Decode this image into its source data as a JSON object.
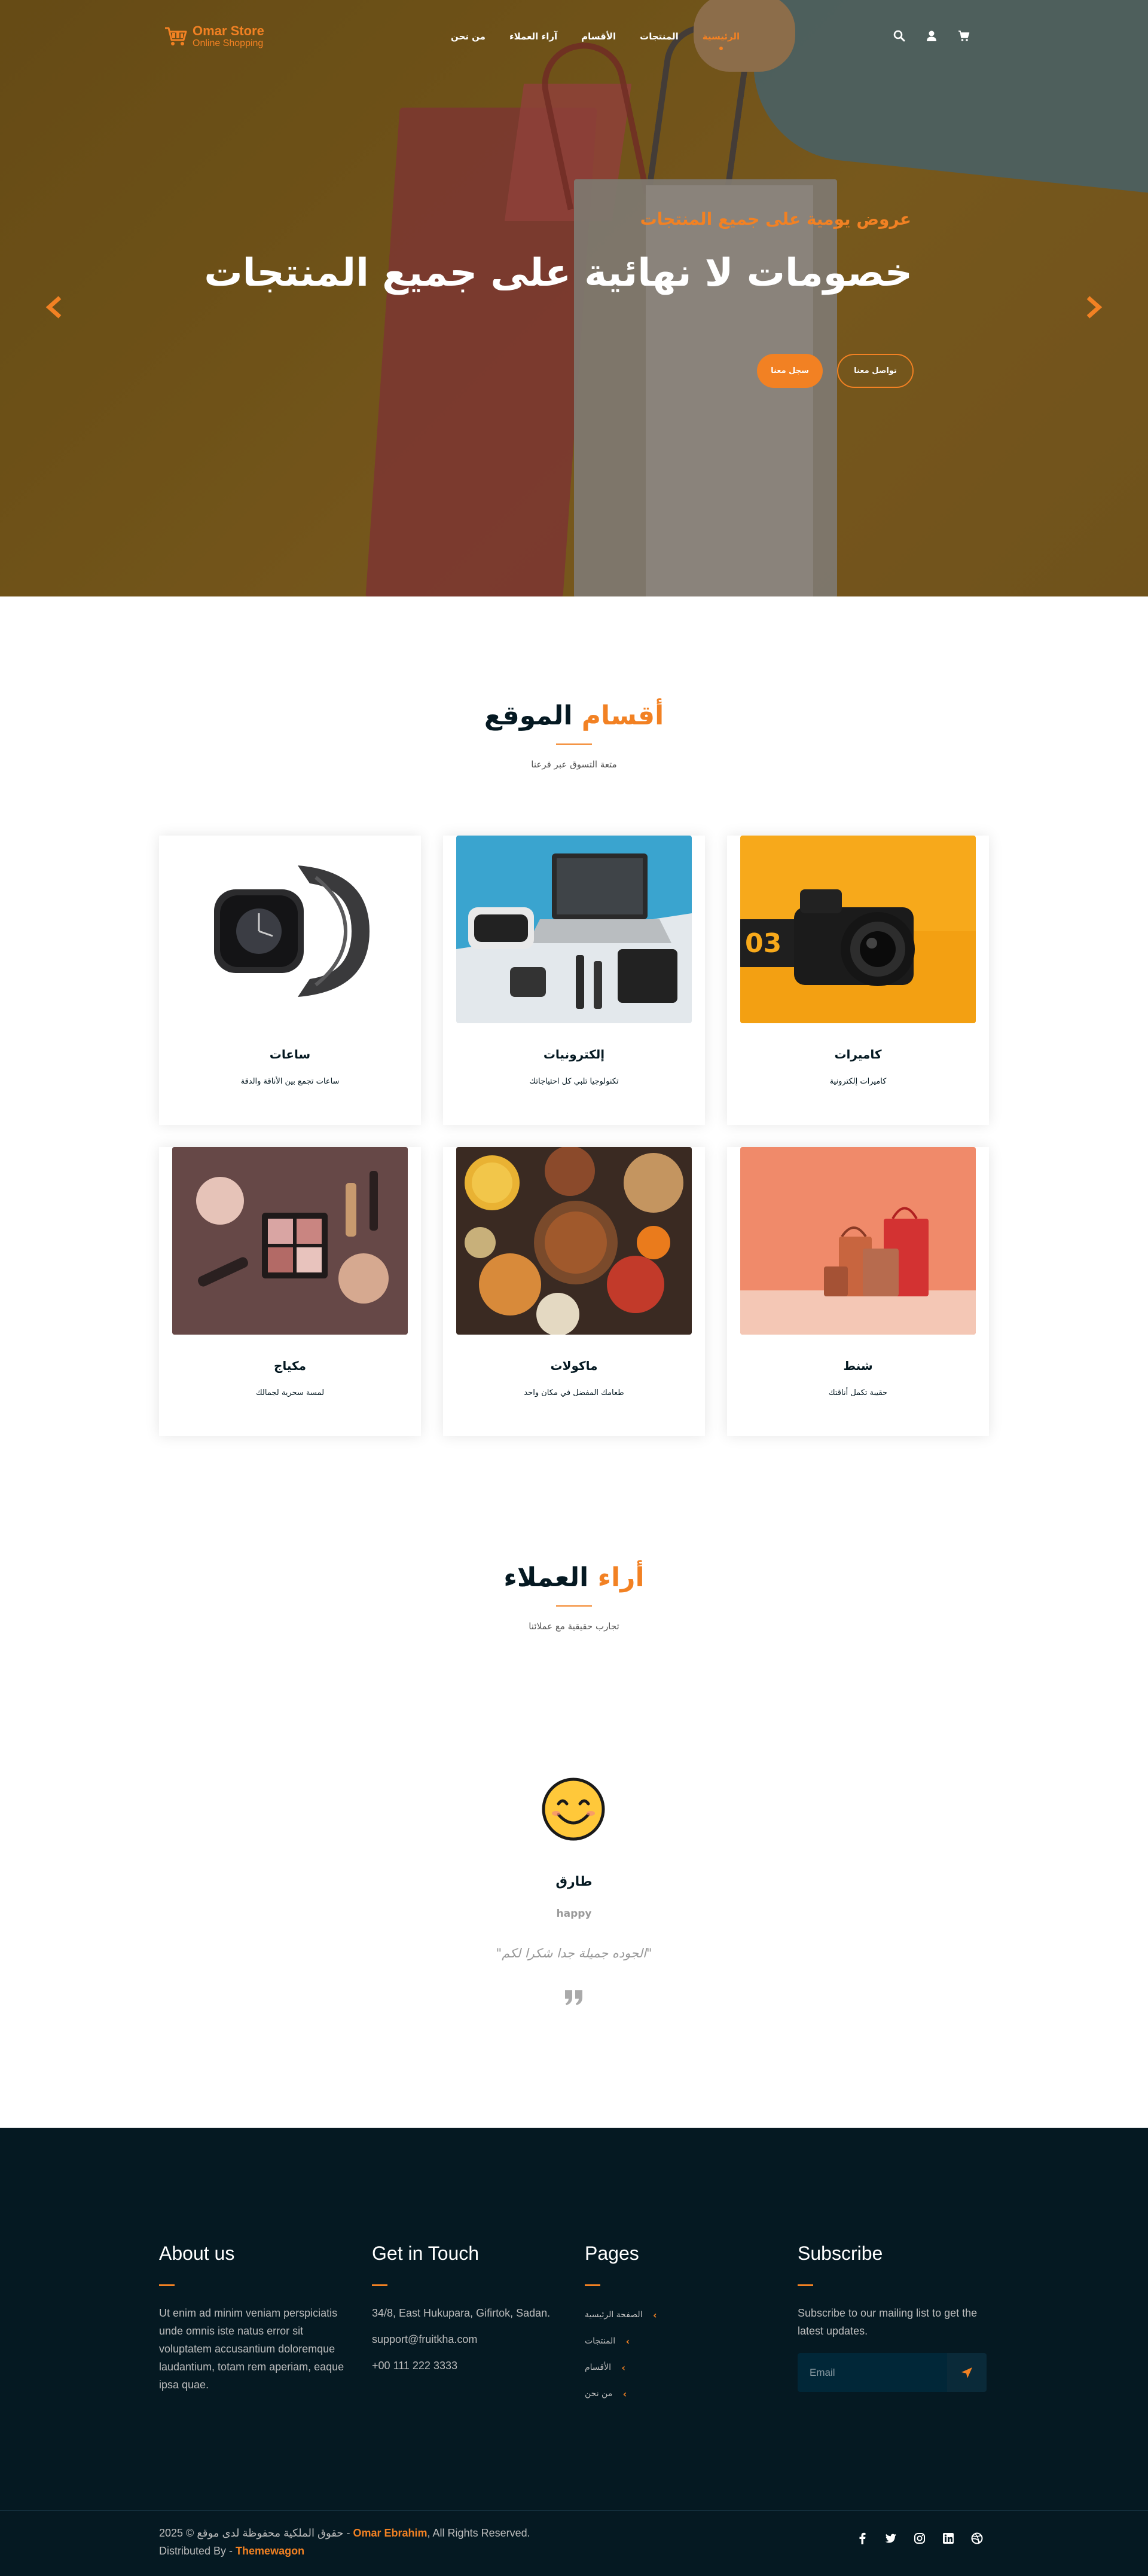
{
  "colors": {
    "accent": "#F28123",
    "dark": "#051922",
    "hero_overlay": "#7a5c1d"
  },
  "brand": {
    "name": "Omar Store",
    "tagline": "Online Shopping"
  },
  "nav": {
    "items": [
      {
        "label": "الرئيسية",
        "active": true
      },
      {
        "label": "المنتجات",
        "active": false
      },
      {
        "label": "الأقسام",
        "active": false
      },
      {
        "label": "آراء العملاء",
        "active": false
      },
      {
        "label": "من نحن",
        "active": false
      }
    ],
    "icons": [
      "search-icon",
      "user-icon",
      "cart-icon"
    ]
  },
  "hero": {
    "subtitle": "عروض يومية على جميع المنتجات",
    "title": "خصومات لا نهائية على جميع المنتجات",
    "btn_primary": "سجل معنا",
    "btn_secondary": "تواصل معنا"
  },
  "categories": {
    "title_accent": "أقسام",
    "title_rest": " الموقع",
    "subtitle": "متعة التسوق عبر فرعنا",
    "items": [
      {
        "title": "كاميرات",
        "desc": "كاميرات إلكترونية",
        "image": "camera"
      },
      {
        "title": "إلكترونيات",
        "desc": "تكنولوجيا تلبي كل احتياجاتك",
        "image": "electronics"
      },
      {
        "title": "ساعات",
        "desc": "ساعات تجمع بين الأناقة والدقة",
        "image": "watch"
      },
      {
        "title": "شنط",
        "desc": "حقيبة تكمل أناقتك",
        "image": "bags"
      },
      {
        "title": "ماكولات",
        "desc": "طعامك المفضل في مكان واحد",
        "image": "food"
      },
      {
        "title": "مكياج",
        "desc": "لمسة سحرية لجمالك",
        "image": "makeup"
      }
    ]
  },
  "testimonials": {
    "title_accent": "أراء",
    "title_rest": " العملاء",
    "subtitle": "تجارب حقيقية مع عملائنا",
    "name": "طارق",
    "role": "happy",
    "quote": "\"الجوده جميلة جدا شكرا لكم\""
  },
  "footer": {
    "about": {
      "title": "About us",
      "text": "Ut enim ad minim veniam perspiciatis unde omnis iste natus error sit voluptatem accusantium doloremque laudantium, totam rem aperiam, eaque ipsa quae."
    },
    "contact": {
      "title": "Get in Touch",
      "address": "34/8, East Hukupara, Gifirtok, Sadan.",
      "email": "support@fruitkha.com",
      "phone": "+00 111 222 3333"
    },
    "pages": {
      "title": "Pages",
      "items": [
        "الصفحة الرئيسية",
        "المنتجات",
        "الأقسام",
        "من نحن"
      ]
    },
    "subscribe": {
      "title": "Subscribe",
      "text": "Subscribe to our mailing list to get the latest updates.",
      "placeholder": "Email"
    }
  },
  "copyright": {
    "prefix": "2025 © حقوق الملكية محفوظة لدى موقع -",
    "author": "Omar Ebrahim",
    "suffix": ", All Rights Reserved.",
    "distributed_prefix": "Distributed By - ",
    "distributed_by": "Themewagon",
    "socials": [
      "facebook-icon",
      "twitter-icon",
      "instagram-icon",
      "linkedin-icon",
      "dribbble-icon"
    ]
  }
}
